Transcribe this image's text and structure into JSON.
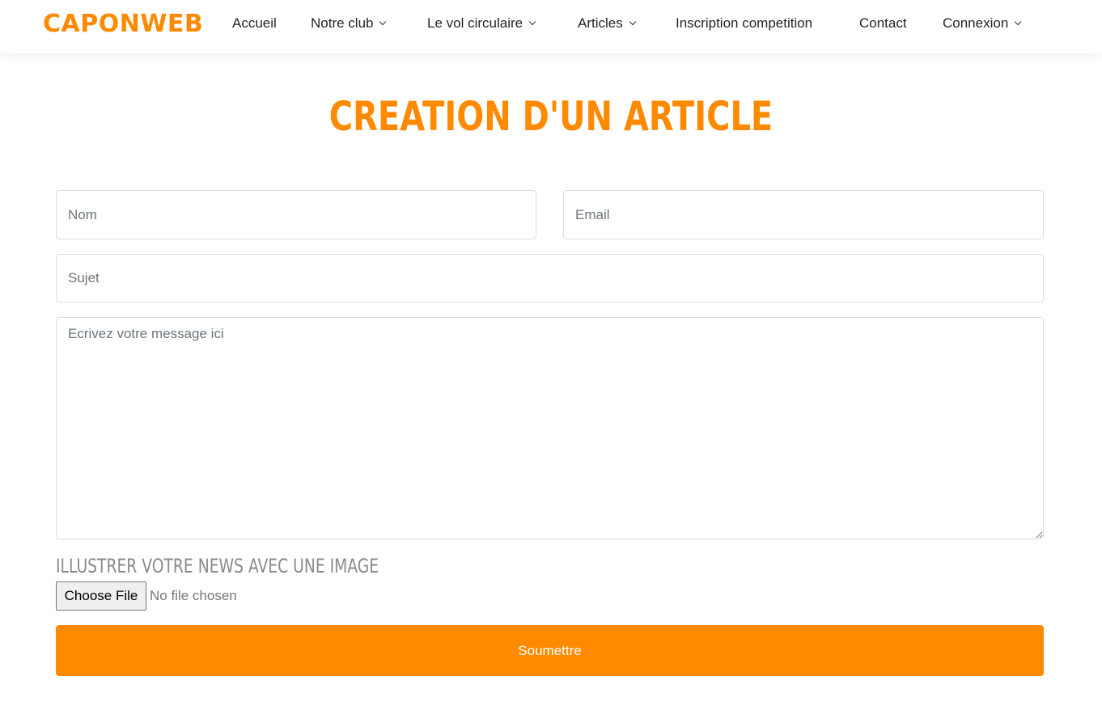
{
  "header": {
    "logo": "CAPONWEB",
    "nav": [
      {
        "label": "Accueil",
        "dropdown": false
      },
      {
        "label": "Notre club",
        "dropdown": true
      },
      {
        "label": "Le vol circulaire",
        "dropdown": true
      },
      {
        "label": "Articles",
        "dropdown": true
      },
      {
        "label": "Inscription competition",
        "dropdown": false
      },
      {
        "label": "Contact",
        "dropdown": false
      },
      {
        "label": "Connexion",
        "dropdown": true
      }
    ]
  },
  "main": {
    "title": "CREATION D'UN ARTICLE",
    "form": {
      "name_placeholder": "Nom",
      "email_placeholder": "Email",
      "subject_placeholder": "Sujet",
      "message_placeholder": "Ecrivez votre message ici",
      "image_label": "ILLUSTRER VOTRE NEWS AVEC UNE IMAGE",
      "file_button": "Choose File",
      "file_status": "No file chosen",
      "submit_label": "Soumettre"
    }
  },
  "colors": {
    "accent": "#ff8a00",
    "text": "#212529",
    "muted": "#8a8a8a",
    "border": "#dddddd"
  }
}
